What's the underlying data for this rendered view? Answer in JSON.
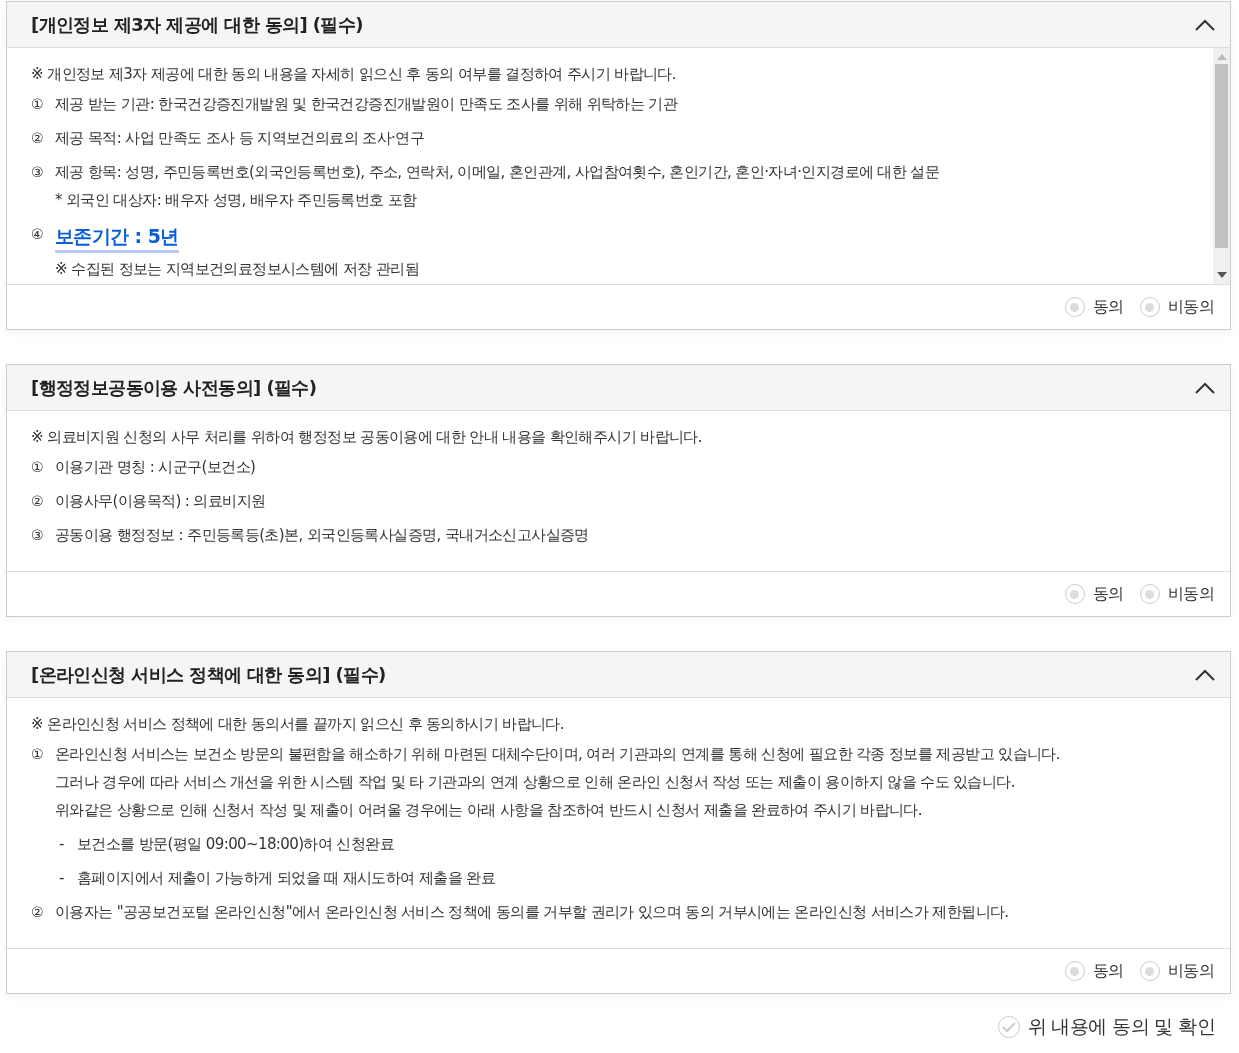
{
  "sections": [
    {
      "title": "[개인정보 제3자 제공에 대한 동의] (필수)",
      "expanded": true,
      "scrollable": true,
      "lines": [
        {
          "kind": "note",
          "text": "※ 개인정보 제3자 제공에 대한 동의 내용을 자세히 읽으신 후 동의 여부를 결정하여 주시기 바랍니다."
        },
        {
          "kind": "item",
          "marker": "①",
          "text": "제공 받는 기관: 한국건강증진개발원 및 한국건강증진개발원이 만족도 조사를 위해 위탁하는 기관"
        },
        {
          "kind": "item",
          "marker": "②",
          "text": "제공 목적: 사업 만족도 조사 등 지역보건의료의 조사·연구"
        },
        {
          "kind": "item",
          "marker": "③",
          "text": "제공 항목: 성명, 주민등록번호(외국인등록번호), 주소, 연락처, 이메일, 혼인관계, 사업참여횟수, 혼인기간, 혼인·자녀·인지경로에 대한 설문",
          "more": [
            "* 외국인 대상자: 배우자 성명, 배우자 주민등록번호 포함"
          ]
        },
        {
          "kind": "highlight",
          "marker": "④",
          "text": "보존기간 : 5년",
          "more": [
            "※ 수집된 정보는 지역보건의료정보시스템에 저장 관리됨"
          ]
        }
      ],
      "options": [
        {
          "label": "동의",
          "selected": false
        },
        {
          "label": "비동의",
          "selected": false
        }
      ]
    },
    {
      "title": "[행정정보공동이용 사전동의] (필수)",
      "expanded": true,
      "scrollable": false,
      "lines": [
        {
          "kind": "note",
          "text": "※ 의료비지원 신청의 사무 처리를 위하여 행정정보 공동이용에 대한 안내 내용을 확인해주시기 바랍니다."
        },
        {
          "kind": "item",
          "marker": "①",
          "text": "이용기관 명칭 : 시군구(보건소)"
        },
        {
          "kind": "item",
          "marker": "②",
          "text": "이용사무(이용목적) : 의료비지원"
        },
        {
          "kind": "item",
          "marker": "③",
          "text": "공동이용 행정정보 : 주민등록등(초)본, 외국인등록사실증명, 국내거소신고사실증명"
        }
      ],
      "options": [
        {
          "label": "동의",
          "selected": false
        },
        {
          "label": "비동의",
          "selected": false
        }
      ]
    },
    {
      "title": "[온라인신청 서비스 정책에 대한 동의] (필수)",
      "expanded": true,
      "scrollable": false,
      "lines": [
        {
          "kind": "note",
          "text": "※ 온라인신청 서비스 정책에 대한 동의서를 끝까지 읽으신 후 동의하시기 바랍니다."
        },
        {
          "kind": "item",
          "marker": "①",
          "text": "온라인신청 서비스는 보건소 방문의 불편함을 해소하기 위해 마련된 대체수단이며, 여러 기관과의 연계를 통해 신청에 필요한 각종 정보를 제공받고 있습니다.",
          "more": [
            "그러나 경우에 따라 서비스 개선을 위한 시스템 작업 및 타 기관과의 연계 상황으로 인해 온라인 신청서 작성 또는 제출이 용이하지 않을 수도 있습니다.",
            "위와같은 상황으로 인해 신청서 작성 및 제출이 어려울 경우에는 아래 사항을 참조하여 반드시 신청서 제출을 완료하여 주시기 바랍니다."
          ]
        },
        {
          "kind": "dash",
          "marker": "-",
          "text": "보건소를 방문(평일 09:00~18:00)하여 신청완료"
        },
        {
          "kind": "dash",
          "marker": "-",
          "text": "홈페이지에서 제출이 가능하게 되었을 때 재시도하여 제출을 완료"
        },
        {
          "kind": "item",
          "marker": "②",
          "text": "이용자는 \"공공보건포털 온라인신청\"에서 온라인신청 서비스 정책에 동의를 거부할 권리가 있으며 동의 거부시에는 온라인신청 서비스가 제한됩니다."
        }
      ],
      "options": [
        {
          "label": "동의",
          "selected": false
        },
        {
          "label": "비동의",
          "selected": false
        }
      ]
    }
  ],
  "confirm": {
    "label": "위 내용에 동의 및 확인",
    "checked": false
  }
}
